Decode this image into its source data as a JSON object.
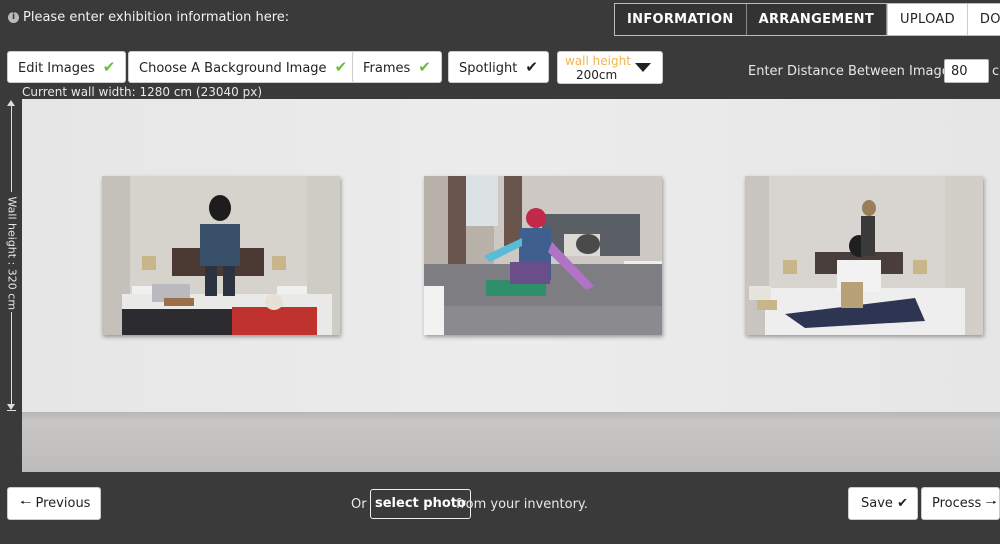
{
  "header": {
    "info_icon": "i",
    "title": "Please enter exhibition information here:",
    "tabs": [
      {
        "label": "INFORMATION"
      },
      {
        "label": "ARRANGEMENT"
      },
      {
        "label": "UPLOAD"
      },
      {
        "label": "DONE"
      }
    ]
  },
  "toolbar": {
    "edit_images": "Edit Images",
    "choose_background": "Choose A Background Image",
    "frames": "Frames",
    "spotlight": "Spotlight",
    "check_glyph": "✔",
    "wall_height_label": "wall height",
    "wall_height_value": "200cm",
    "distance_label": "Enter Distance Between Images:",
    "distance_value": "80",
    "distance_unit": "cm"
  },
  "wall": {
    "current_width": "Current wall width: 1280 cm (23040 px)",
    "height_label": "Wall height : 320 cm"
  },
  "footer": {
    "previous": "Previous",
    "or_text": "Or",
    "select_photo": "select photo",
    "inventory_text": "from your inventory.",
    "save": "Save",
    "process": "Process"
  },
  "icons": {
    "check_color": "#6abf3a",
    "wall_height_label_color": "#f0b54d"
  }
}
